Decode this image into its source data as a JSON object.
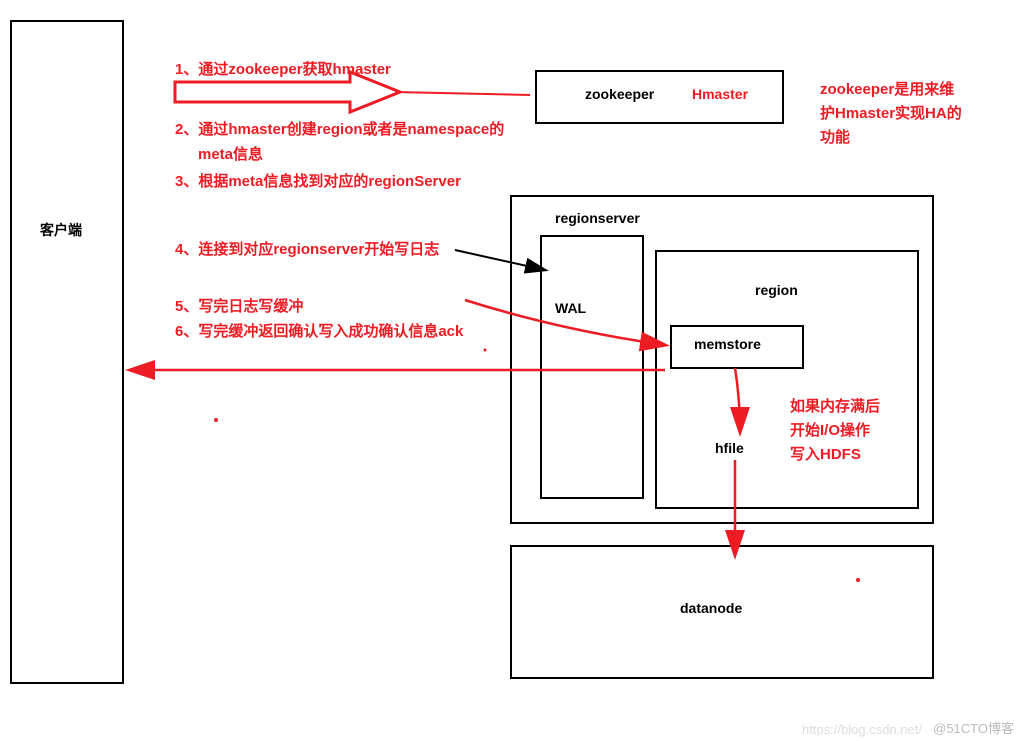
{
  "client_label": "客户端",
  "zookeeper_label": "zookeeper",
  "hmaster_label": "Hmaster",
  "regionserver_label": "regionserver",
  "wal_label": "WAL",
  "region_label": "region",
  "memstore_label": "memstore",
  "hfile_label": "hfile",
  "datanode_label": "datanode",
  "step1": "1、通过zookeeper获取hmaster",
  "step2_line1": "2、通过hmaster创建region或者是namespace的",
  "step2_line2": "meta信息",
  "step3": "3、根据meta信息找到对应的regionServer",
  "step4": "4、连接到对应regionserver开始写日志",
  "step5": "5、写完日志写缓冲",
  "step6": "6、写完缓冲返回确认写入成功确认信息ack",
  "note_zk_line1": "zookeeper是用来维",
  "note_zk_line2": "护Hmaster实现HA的",
  "note_zk_line3": "功能",
  "note_mem_line1": "如果内存满后",
  "note_mem_line2": "开始I/O操作",
  "note_mem_line3": "写入HDFS",
  "watermark1": "https://blog.csdn.net/",
  "watermark2": "@51CTO博客"
}
